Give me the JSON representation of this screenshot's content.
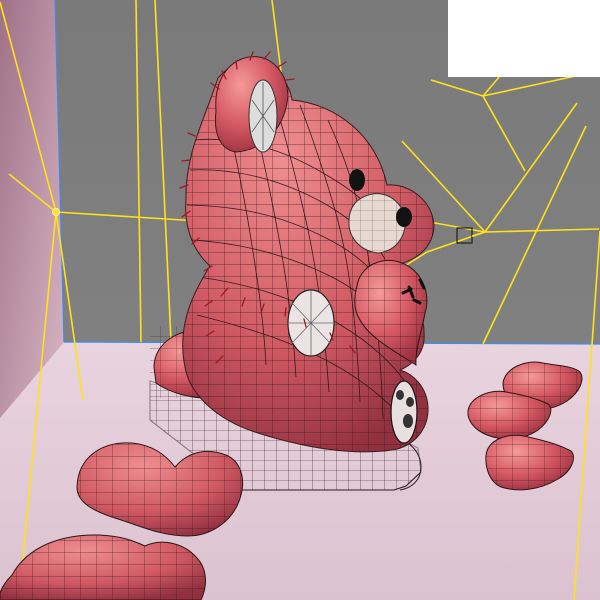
{
  "viewport": {
    "background_top": "#7b7b7b",
    "background_left_wall": "#aa7e96",
    "floor": "#e3ccd6",
    "accent_yellow": "#ffe21a",
    "accent_blue": "#3f8be8",
    "model_pink": "#d45a62",
    "model_pink_dark": "#a73845",
    "mesh_dark": "#2a1717",
    "fur_red": "#9f1725",
    "eye_black": "#111111",
    "muzzle": "#e8d8d0",
    "pillow": "#f3f2f4"
  },
  "scene": {
    "objects": [
      "teddy-bear",
      "heart-pillows",
      "camera-target",
      "yellow-wire-lines",
      "grid-mat"
    ],
    "labels": []
  }
}
